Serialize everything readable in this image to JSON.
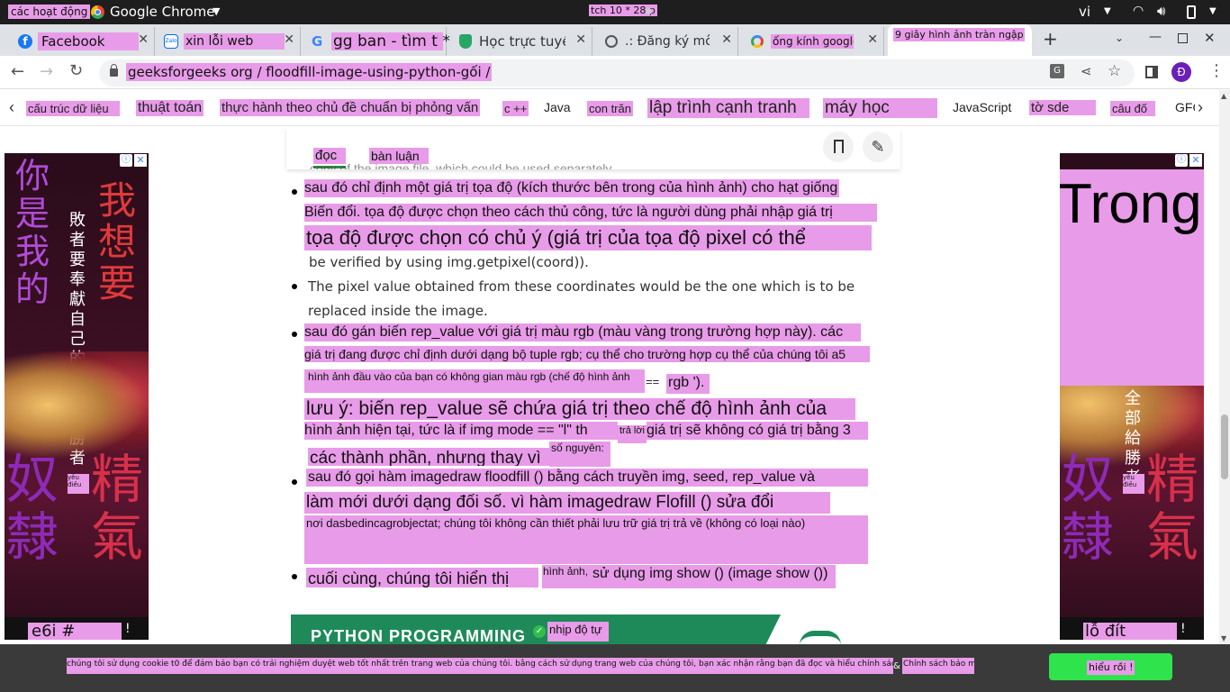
{
  "system_bar": {
    "activities": "các hoạt động",
    "app_name": "Google Chrome",
    "clock": "tch 10 * 28 p",
    "lang": "vi"
  },
  "tabs": [
    {
      "label": "Facebook",
      "icon": "facebook-icon"
    },
    {
      "label": "xin lỗi web",
      "icon": "zalo-icon"
    },
    {
      "label": "gg ban - tìm t *",
      "icon": "google-icon"
    },
    {
      "label": "Học trực tuyế",
      "icon": "shield-icon"
    },
    {
      "label": ".: Đăng ký môn",
      "icon": "globe-icon"
    },
    {
      "label": "ống kính google",
      "icon": "lens-icon"
    },
    {
      "label": "9 giây hình ảnh tràn ngập x",
      "icon": ""
    }
  ],
  "address_bar": {
    "url": "geeksforgeeks org / floodfill-image-using-python-gối /",
    "profile_initial": "Đ"
  },
  "nav": {
    "items": [
      "cấu trúc dữ liệu",
      "thuật toán",
      "thực hành theo chủ đề chuẩn bị phỏng vấn",
      "c ++",
      "Java",
      "con trăn",
      "lập trình cạnh tranh",
      "máy học",
      "JavaScript",
      "tờ sde",
      "câu đố",
      "GFG"
    ]
  },
  "article_toolbar": {
    "read": "đọc",
    "discuss": "bàn luận"
  },
  "article": {
    "partial_top": "copy of the image file, which could be used separately.",
    "b1_l1": "sau đó chỉ định một giá trị tọa độ (kích thước bên trong của hình ảnh) cho hạt giống",
    "b1_l2": "Biến đổi. tọa độ được chọn theo cách thủ công, tức là người dùng phải nhập giá trị",
    "b1_l3": "tọa độ được chọn có chủ ý (giá trị của tọa độ pixel có thể",
    "b1_l4": "be verified by using img.getpixel(coord)).",
    "b2_l1": "The pixel value obtained from these coordinates would be the one which is to be",
    "b2_l2": "replaced inside the image.",
    "b3_l1": "sau đó gán biến rep_value với giá trị màu rgb (màu vàng trong trường hợp này). các",
    "b3_l2": "giá trị đang được chỉ định dưới dạng bộ tuple rgb; cụ thể cho trường hợp cụ thể của chúng tôi a5",
    "b3_l3a": "hình ảnh đầu vào của bạn có không gian màu rgb (chế độ hình ảnh",
    "b3_l3b": "==",
    "b3_l3c": "rgb ').",
    "b3_l4": "lưu ý: biến rep_value sẽ chứa giá trị theo chế độ hình ảnh của",
    "b3_l5a": "hình ảnh hiện tại, tức là if img mode == \"l\" th",
    "b3_l5b": "trả lời",
    "b3_l5c": "giá trị sẽ không có giá trị bằng 3",
    "b3_l6a": "các thành phần, nhưng thay vì",
    "b3_l6b": "số nguyên:",
    "b4_l1": "sau đó gọi hàm imagedraw floodfill () bằng cách truyền img, seed, rep_value và",
    "b4_l2": "làm mới dưới dạng đối số. vì hàm imagedraw Flofill () sửa đổi",
    "b4_l3": "nơi dasbedincagrobjectat; chúng tôi không cần thiết phải lưu trữ giá trị trả về (không có loại nào)",
    "b5_l1a": "cuối cùng, chúng tôi hiển thị",
    "b5_l1b": "hình ảnh,",
    "b5_l1c": "sử dụng img show () (image show ())",
    "banner_title": "PYTHON PROGRAMMING",
    "banner_badge": "nhịp độ tự"
  },
  "ads": {
    "left_footer": "e6i # duyệt",
    "left_small": "yêu điều",
    "right_big": "Trong",
    "right_footer": "lỗ đít",
    "right_small": "yêu điều",
    "left_text1": "你是我的",
    "left_text2": "我想要",
    "left_text3": "敗者要奉獻自己的全部給勝者",
    "left_text4": "奴隸",
    "left_text5": "精氣",
    "right_text1": "全部給勝者",
    "right_text2": "奴隸",
    "right_text3": "精氣"
  },
  "cookie": {
    "text": "chúng tôi sử dụng cookie t0 để đảm bảo bạn có trải nghiệm duyệt web tốt nhất trên trang web của chúng tôi. bằng cách sử dụng trang web của chúng tôi, bạn xác nhận rằng bạn đã đọc và hiểu chính sách cookie của chúng tôi",
    "amp": "&",
    "policy": "Chính sách bảo mật",
    "button": "hiểu rồi !"
  },
  "colors": {
    "highlight": "#e89be8",
    "accent_green": "#2fe34d",
    "gfg_green": "#2f8d46",
    "dark_bar": "#1e1e1e",
    "ad_bg": "#2a0c1a"
  }
}
